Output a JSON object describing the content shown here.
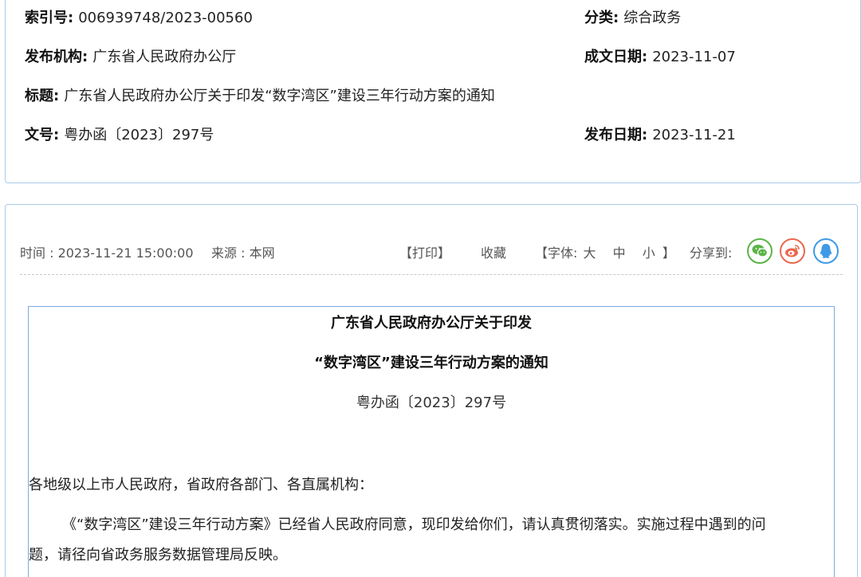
{
  "meta": {
    "index_label": "索引号:",
    "index_value": "006939748/2023-00560",
    "category_label": "分类:",
    "category_value": "综合政务",
    "publisher_label": "发布机构:",
    "publisher_value": "广东省人民政府办公厅",
    "written_date_label": "成文日期:",
    "written_date_value": "2023-11-07",
    "title_label": "标题:",
    "title_value": "广东省人民政府办公厅关于印发“数字湾区”建设三年行动方案的通知",
    "doc_no_label": "文号:",
    "doc_no_value": "粤办函〔2023〕297号",
    "publish_date_label": "发布日期:",
    "publish_date_value": "2023-11-21"
  },
  "toolbar": {
    "time_text": "时间 : 2023-11-21 15:00:00",
    "source_text": "来源 : 本网",
    "print_label": "【打印】",
    "favorite_label": "收藏",
    "font_prefix": "【字体:",
    "font_large": "大",
    "font_medium": "中",
    "font_small": "小",
    "font_suffix": "】",
    "share_label": "分享到:",
    "share_icons": [
      "wechat-icon",
      "weibo-icon",
      "qq-icon"
    ],
    "colors": {
      "wechat": "#5bb446",
      "weibo": "#e9684f",
      "qq": "#3f9ae5"
    }
  },
  "article": {
    "title_line1": "广东省人民政府办公厅关于印发",
    "title_line2": "“数字湾区”建设三年行动方案的通知",
    "doc_number": "粤办函〔2023〕297号",
    "salutation": "各地级以上市人民政府，省政府各部门、各直属机构：",
    "body_line1": "《“数字湾区”建设三年行动方案》已经省人民政府同意，现印发给你们，请认真贯彻落实。实施过程中遇到的问",
    "body_line2": "题，请径向省政务服务数据管理局反映。"
  }
}
